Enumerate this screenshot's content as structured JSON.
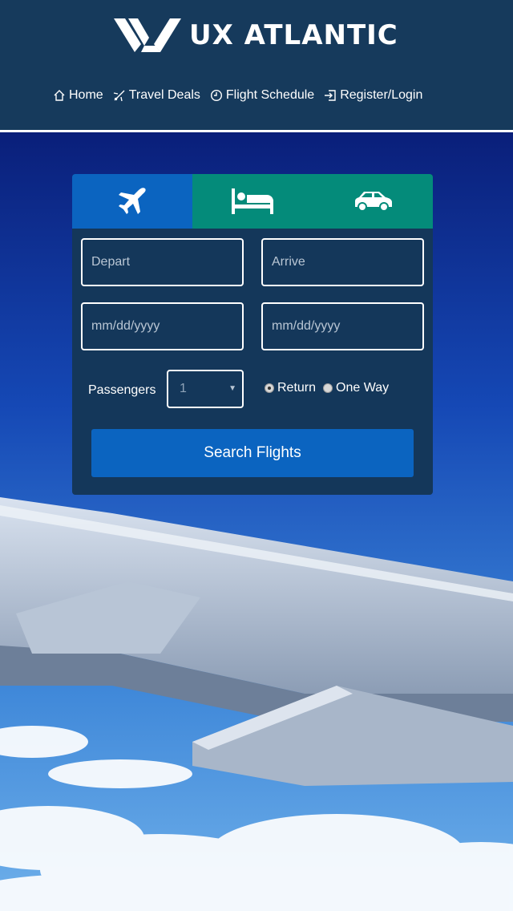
{
  "brand": {
    "name": "UX ATLANTIC"
  },
  "nav": [
    {
      "label": "Home",
      "icon": "home-icon"
    },
    {
      "label": "Travel Deals",
      "icon": "airplane-icon"
    },
    {
      "label": "Flight Schedule",
      "icon": "clock-icon"
    },
    {
      "label": "Register/Login",
      "icon": "login-icon"
    }
  ],
  "tabs": [
    {
      "name": "flights",
      "icon": "airplane-icon",
      "active": true
    },
    {
      "name": "hotels",
      "icon": "bed-icon",
      "active": false
    },
    {
      "name": "cars",
      "icon": "car-icon",
      "active": false
    }
  ],
  "form": {
    "depart_placeholder": "Depart",
    "arrive_placeholder": "Arrive",
    "depart_date_placeholder": "mm/dd/yyyy",
    "return_date_placeholder": "mm/dd/yyyy",
    "passengers_label": "Passengers",
    "passengers_value": "1",
    "trip_options": [
      "Return",
      "One Way"
    ],
    "trip_selected": "Return",
    "search_label": "Search Flights"
  },
  "colors": {
    "header": "#163a5c",
    "panel": "#14375a",
    "primary": "#0b64c0",
    "teal": "#048b7a"
  }
}
